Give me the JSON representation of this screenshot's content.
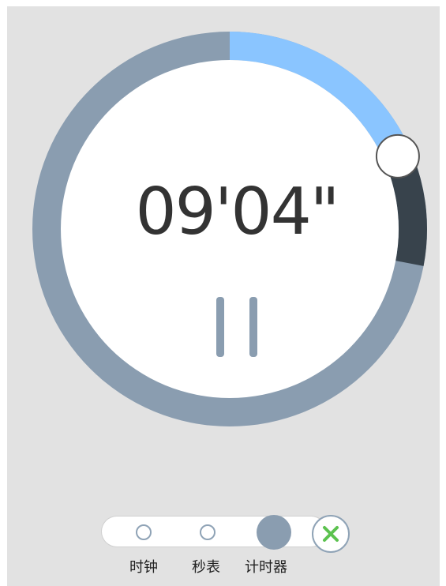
{
  "timer": {
    "display": "09'04\"",
    "progress_fraction": 0.14,
    "handle_fraction": 0.19,
    "segment_end_fraction": 0.28
  },
  "modes": [
    {
      "label": "时钟",
      "active": false
    },
    {
      "label": "秒表",
      "active": false
    },
    {
      "label": "计时器",
      "active": true
    }
  ],
  "colors": {
    "background": "#e2e2e2",
    "ring_track": "#8a9db0",
    "ring_progress": "#8ac5ff",
    "ring_segment": "#38434c",
    "face": "#ffffff",
    "text": "#333333",
    "close_x": "#5cc24f"
  },
  "icons": {
    "pause": "pause-icon",
    "close": "close-icon"
  }
}
